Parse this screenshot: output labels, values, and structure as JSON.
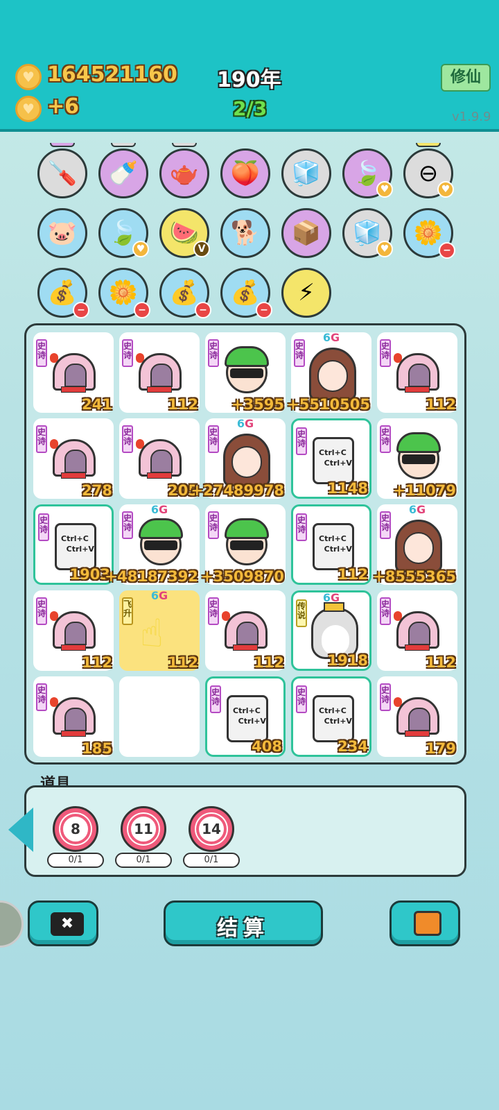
{
  "header": {
    "gold": "164521160",
    "income": "+6",
    "year": "190年",
    "round": "2/3",
    "xiuxian_label": "修仙",
    "version": "v1.9.9"
  },
  "items": [
    {
      "name": "screwdriver-icon",
      "icon": "🪛"
    },
    {
      "name": "breast-pump-icon",
      "icon": "🍼"
    },
    {
      "name": "gravy-boat-icon",
      "icon": "🫖"
    },
    {
      "name": "blindfold-peach-icon",
      "icon": "🍑"
    },
    {
      "name": "sugar-cubes-icon",
      "icon": "🧊"
    },
    {
      "name": "leaf-icon",
      "icon": "🍃"
    },
    {
      "name": "minus-sign-icon",
      "icon": "⊖"
    },
    {
      "name": "piggy-bank-icon",
      "icon": "🐷"
    },
    {
      "name": "leaf-icon",
      "icon": "🍃"
    },
    {
      "name": "fruit-platter-icon",
      "icon": "🍉"
    },
    {
      "name": "cool-dog-icon",
      "icon": "🐕"
    },
    {
      "name": "box-icon",
      "icon": "📦"
    },
    {
      "name": "sugar-cubes-icon",
      "icon": "🧊"
    },
    {
      "name": "potted-flower-icon",
      "icon": "🌼"
    },
    {
      "name": "sack-icon",
      "icon": "💰"
    },
    {
      "name": "potted-flower-icon",
      "icon": "🌼"
    },
    {
      "name": "sack-icon",
      "icon": "💰"
    },
    {
      "name": "sack-icon",
      "icon": "💰"
    },
    {
      "name": "lightning-icon",
      "icon": "⚡"
    }
  ],
  "tags": {
    "epic": "史诗",
    "legend": "传说",
    "fly": "飞升"
  },
  "g6": {
    "six": "6",
    "g": "G"
  },
  "cards_text": {
    "line1": "Ctrl+C",
    "line2": "Ctrl+V"
  },
  "grid": [
    [
      {
        "type": "house",
        "value": "241"
      },
      {
        "type": "house",
        "value": "112"
      },
      {
        "type": "guy",
        "value": "+3595"
      },
      {
        "type": "girl",
        "value": "+5510505",
        "g6": true
      },
      {
        "type": "house",
        "value": "112"
      }
    ],
    [
      {
        "type": "house",
        "value": "278"
      },
      {
        "type": "house",
        "value": "205"
      },
      {
        "type": "girl",
        "value": "+27489978",
        "g6": true
      },
      {
        "type": "cards",
        "value": "1148"
      },
      {
        "type": "guy",
        "value": "+11079"
      }
    ],
    [
      {
        "type": "cards",
        "value": "1903"
      },
      {
        "type": "guy",
        "value": "+48187392",
        "g6": true
      },
      {
        "type": "guy",
        "value": "+3509870"
      },
      {
        "type": "cards",
        "value": "112"
      },
      {
        "type": "girl",
        "value": "+8555365",
        "g6": true
      }
    ],
    [
      {
        "type": "house",
        "value": "112"
      },
      {
        "type": "hand",
        "value": "112",
        "g6": true
      },
      {
        "type": "house",
        "value": "112"
      },
      {
        "type": "dog",
        "value": "1918",
        "g6": true
      },
      {
        "type": "house",
        "value": "112"
      }
    ],
    [
      {
        "type": "house",
        "value": "185"
      },
      {
        "type": "empty",
        "value": ""
      },
      {
        "type": "cards",
        "value": "408"
      },
      {
        "type": "cards",
        "value": "234"
      },
      {
        "type": "house",
        "value": "179"
      }
    ]
  ],
  "props": {
    "title": "道具",
    "items": [
      {
        "level": "8",
        "count": "0/1"
      },
      {
        "level": "11",
        "count": "0/1"
      },
      {
        "level": "14",
        "count": "0/1"
      }
    ]
  },
  "buttons": {
    "settle": "结算",
    "close_icon": "✖"
  }
}
